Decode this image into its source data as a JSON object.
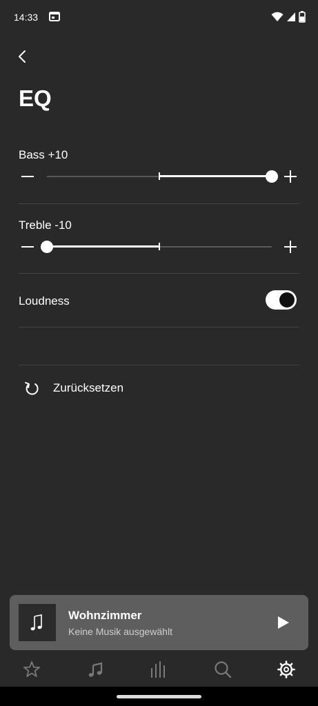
{
  "status_bar": {
    "time": "14:33"
  },
  "header": {
    "title": "EQ"
  },
  "bass": {
    "label": "Bass +10",
    "value": 10,
    "min": -10,
    "max": 10
  },
  "treble": {
    "label": "Treble -10",
    "value": -10,
    "min": -10,
    "max": 10
  },
  "loudness": {
    "label": "Loudness",
    "on": true
  },
  "reset": {
    "label": "Zurücksetzen"
  },
  "mini_player": {
    "room": "Wohnzimmer",
    "status": "Keine Musik ausgewählt"
  },
  "tabs": [
    "star-icon",
    "music-note-icon",
    "rooms-bars-icon",
    "search-icon",
    "gear-icon"
  ],
  "colors": {
    "background": "#292929",
    "player": "#5e5e5e",
    "accent": "#ffffff"
  }
}
